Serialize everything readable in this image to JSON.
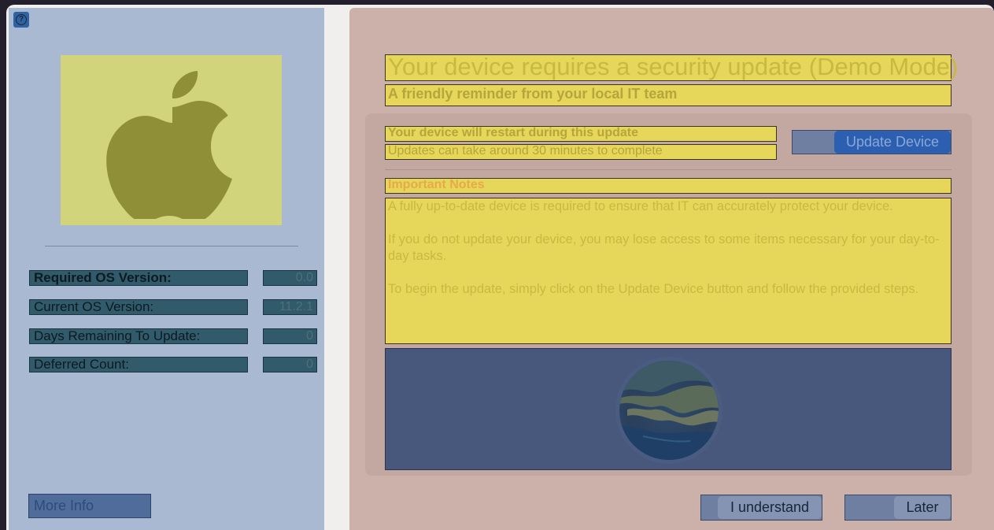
{
  "left": {
    "info_rows": [
      {
        "label": "Required OS Version:",
        "value": "0.0"
      },
      {
        "label": "Current OS Version:",
        "value": "11.2.1"
      },
      {
        "label": "Days Remaining To Update:",
        "value": "0"
      },
      {
        "label": "Deferred Count:",
        "value": "0"
      }
    ],
    "more_info_label": "More Info"
  },
  "header": {
    "title": "Your device requires a security update (Demo Mode)",
    "subtitle": "A friendly reminder from your local IT team"
  },
  "card": {
    "restart_text": "Your device will restart during this update",
    "duration_text": "Updates can take around 30 minutes to complete",
    "update_button_label": "Update Device",
    "notes_title": "Important Notes",
    "notes_paragraphs": [
      "A fully up-to-date device is required to ensure that IT can accurately protect your device.",
      "If you do not update your device, you may lose access to some items necessary for your day-to-day tasks.",
      "To begin the update, simply click on the Update Device button and follow the provided steps."
    ]
  },
  "footer": {
    "understand_label": "I understand",
    "later_label": "Later"
  },
  "icons": {
    "help": "question-icon",
    "logo": "apple-logo",
    "image": "macos-big-sur-disc"
  },
  "colors": {
    "left_pane": "#a9b9d2",
    "right_pane": "#ccb1aa",
    "highlight": "#e6d75a",
    "accent_button": "#2d5fb0",
    "important": "#e8a94a"
  }
}
